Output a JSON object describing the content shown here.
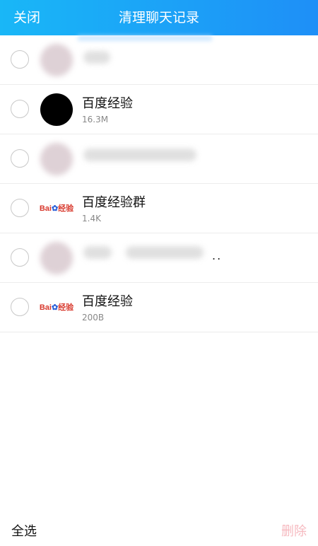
{
  "header": {
    "close_label": "关闭",
    "title": "清理聊天记录"
  },
  "chats": [
    {
      "name": "",
      "size": "",
      "avatar": "blurred",
      "checked": false
    },
    {
      "name": "百度经验",
      "size": "16.3M",
      "avatar": "black",
      "checked": false
    },
    {
      "name": "",
      "size": "",
      "avatar": "blurred",
      "checked": false
    },
    {
      "name": "百度经验群",
      "size": "1.4K",
      "avatar": "baidu-logo",
      "checked": false
    },
    {
      "name": "",
      "size": "",
      "avatar": "blurred",
      "checked": false
    },
    {
      "name": "百度经验",
      "size": "200B",
      "avatar": "baidu-logo",
      "checked": false
    }
  ],
  "logo": {
    "bai": "Bai",
    "paw": "✿",
    "jingyan": "经验"
  },
  "row5_trailing": "..",
  "footer": {
    "select_all_label": "全选",
    "delete_label": "删除"
  },
  "colors": {
    "header_start": "#19b7f7",
    "header_end": "#1e8ff7",
    "delete_disabled": "#f6b9bf"
  }
}
